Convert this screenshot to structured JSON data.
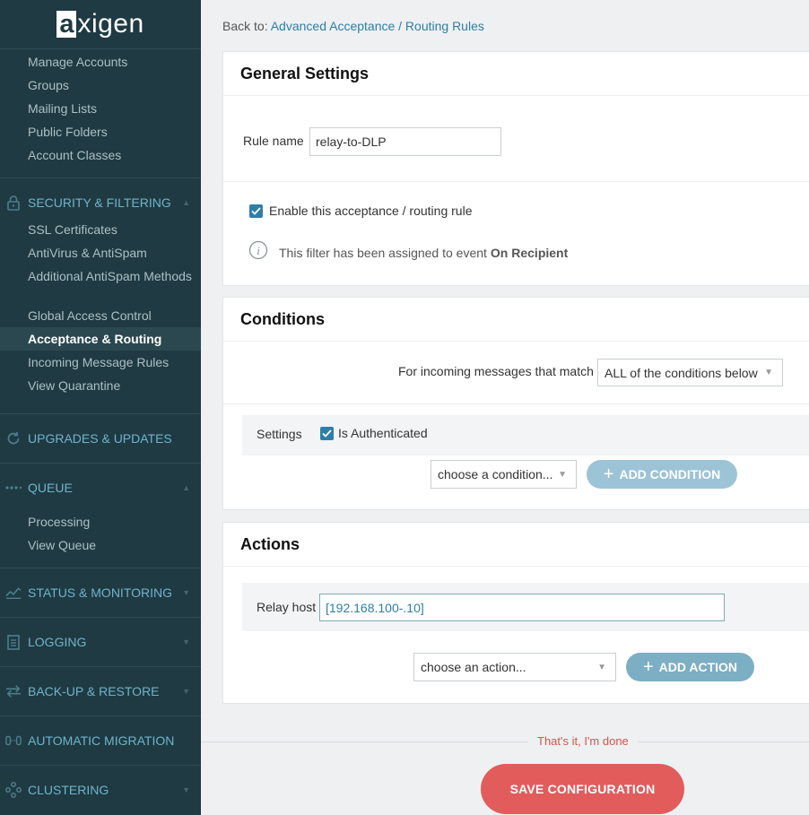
{
  "logo": {
    "first_letter": "a",
    "rest": "xigen"
  },
  "sidebar": {
    "accounts_items": [
      "Manage Accounts",
      "Groups",
      "Mailing Lists",
      "Public Folders",
      "Account Classes"
    ],
    "security": {
      "label": "SECURITY & FILTERING",
      "items": [
        "SSL Certificates",
        "AntiVirus & AntiSpam",
        "Additional AntiSpam Methods",
        "Global Access Control",
        "Acceptance & Routing",
        "Incoming Message Rules",
        "View Quarantine"
      ],
      "active_item": "Acceptance & Routing"
    },
    "upgrades": {
      "label": "UPGRADES & UPDATES"
    },
    "queue": {
      "label": "QUEUE",
      "items": [
        "Processing",
        "View Queue"
      ]
    },
    "status": {
      "label": "STATUS & MONITORING"
    },
    "logging": {
      "label": "LOGGING"
    },
    "backup": {
      "label": "BACK-UP & RESTORE"
    },
    "migration": {
      "label": "AUTOMATIC MIGRATION"
    },
    "clustering": {
      "label": "CLUSTERING"
    }
  },
  "breadcrumb": {
    "prefix": "Back to:",
    "link": "Advanced Acceptance / Routing Rules"
  },
  "general": {
    "title": "General Settings",
    "rule_name_label": "Rule name",
    "rule_name_value": "relay-to-DLP",
    "enable_label": "Enable this acceptance / routing rule",
    "enable_checked": true,
    "info_prefix": "This filter has been assigned to event",
    "info_event": "On Recipient"
  },
  "conditions": {
    "title": "Conditions",
    "match_label": "For incoming messages that match",
    "match_value": "ALL of the conditions below",
    "settings_label": "Settings",
    "is_authenticated_label": "Is Authenticated",
    "is_authenticated_checked": true,
    "choose_placeholder": "choose a condition...",
    "add_button": "ADD CONDITION"
  },
  "actions": {
    "title": "Actions",
    "relay_label": "Relay host",
    "relay_value": "[192.168.100-.10]",
    "choose_placeholder": "choose an action...",
    "add_button": "ADD ACTION"
  },
  "footer": {
    "done_text": "That's it, I'm done",
    "save_button": "SAVE CONFIGURATION"
  },
  "colors": {
    "sidebar_bg": "#1f3a42",
    "accent": "#2e7ea8",
    "save": "#e25c5c",
    "section_text": "#6fb4cc"
  }
}
